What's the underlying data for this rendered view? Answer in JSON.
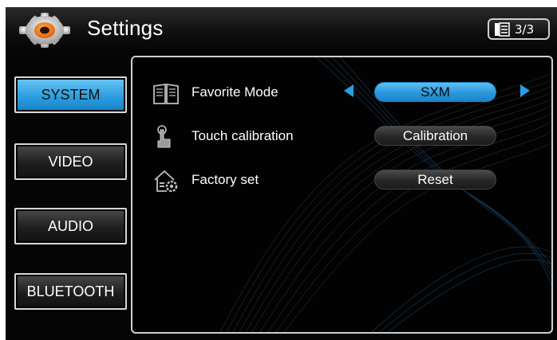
{
  "header": {
    "title": "Settings",
    "page_indicator": "3/3"
  },
  "sidebar": {
    "items": [
      {
        "label": "SYSTEM",
        "active": true
      },
      {
        "label": "VIDEO",
        "active": false
      },
      {
        "label": "AUDIO",
        "active": false
      },
      {
        "label": "BLUETOOTH",
        "active": false
      }
    ]
  },
  "settings": {
    "favorite_mode": {
      "label": "Favorite Mode",
      "value": "SXM",
      "icon": "book-icon"
    },
    "touch_calibration": {
      "label": "Touch calibration",
      "button": "Calibration",
      "icon": "touch-hand-icon"
    },
    "factory_set": {
      "label": "Factory set",
      "button": "Reset",
      "icon": "house-gear-icon"
    }
  },
  "colors": {
    "accent": "#2a9ee4",
    "active_button": "#2d9ee0",
    "background": "#050505"
  }
}
